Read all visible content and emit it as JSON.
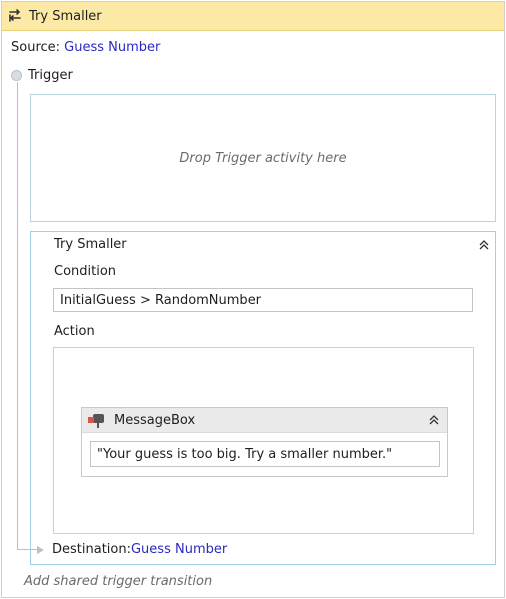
{
  "header": {
    "title": "Try Smaller",
    "icon": "transition-icon"
  },
  "source": {
    "label": "Source: ",
    "value": "Guess Number"
  },
  "trigger": {
    "label": "Trigger",
    "drop_placeholder": "Drop Trigger activity here"
  },
  "transition": {
    "name": "Try Smaller",
    "condition_label": "Condition",
    "condition_value": "InitialGuess > RandomNumber",
    "action_label": "Action",
    "messagebox": {
      "title": "MessageBox",
      "text_value": "\"Your guess is too big. Try a smaller number.\""
    },
    "destination_label": "Destination: ",
    "destination_value": "Guess Number"
  },
  "footer": {
    "add_shared_label": "Add shared trigger transition"
  },
  "colors": {
    "header_bg": "#fde9a6",
    "link": "#2a2ac2",
    "border_accent": "#9fd3e3"
  }
}
